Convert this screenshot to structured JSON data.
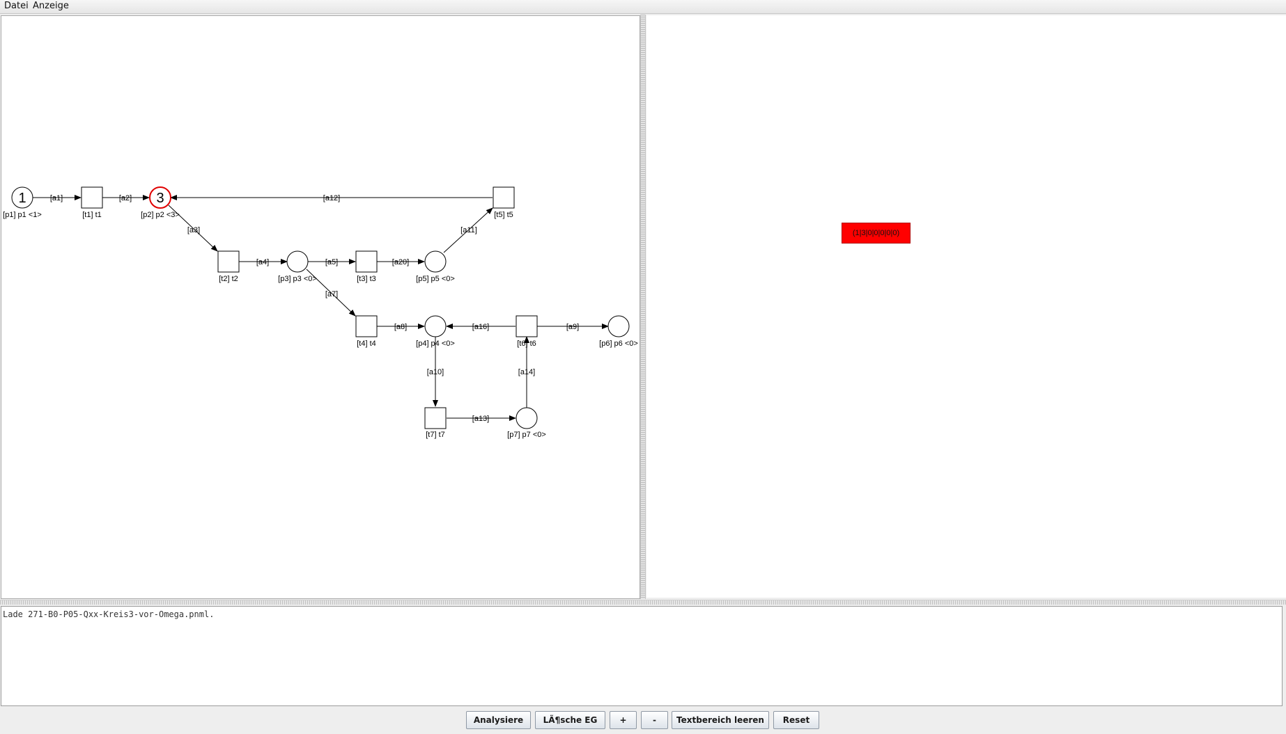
{
  "menu": {
    "file": "Datei",
    "view": "Anzeige"
  },
  "colors": {
    "state_fill": "#ff0000",
    "active_place": "#e00000"
  },
  "petri_net": {
    "places": [
      {
        "id": "p1",
        "label": "[p1] p1 <1>",
        "tokens": "1"
      },
      {
        "id": "p2",
        "label": "[p2] p2 <3>",
        "tokens": "3"
      },
      {
        "id": "p3",
        "label": "[p3] p3 <0>",
        "tokens": ""
      },
      {
        "id": "p5",
        "label": "[p5] p5 <0>",
        "tokens": ""
      },
      {
        "id": "p4",
        "label": "[p4] p4 <0>",
        "tokens": ""
      },
      {
        "id": "p6",
        "label": "[p6] p6 <0>",
        "tokens": ""
      },
      {
        "id": "p7",
        "label": "[p7] p7 <0>",
        "tokens": ""
      }
    ],
    "transitions": [
      {
        "id": "t1",
        "label": "[t1] t1"
      },
      {
        "id": "t5",
        "label": "[t5] t5"
      },
      {
        "id": "t2",
        "label": "[t2] t2"
      },
      {
        "id": "t3",
        "label": "[t3] t3"
      },
      {
        "id": "t4",
        "label": "[t4] t4"
      },
      {
        "id": "t6",
        "label": "[t6] t6"
      },
      {
        "id": "t7",
        "label": "[t7] t7"
      }
    ],
    "arcs": [
      {
        "id": "a1",
        "label": "[a1]"
      },
      {
        "id": "a2",
        "label": "[a2]"
      },
      {
        "id": "a12",
        "label": "[a12]"
      },
      {
        "id": "a3",
        "label": "[a3]"
      },
      {
        "id": "a11",
        "label": "[a11]"
      },
      {
        "id": "a4",
        "label": "[a4]"
      },
      {
        "id": "a5",
        "label": "[a5]"
      },
      {
        "id": "a20",
        "label": "[a20]"
      },
      {
        "id": "a7",
        "label": "[a7]"
      },
      {
        "id": "a8",
        "label": "[a8]"
      },
      {
        "id": "a16",
        "label": "[a16]"
      },
      {
        "id": "a9",
        "label": "[a9]"
      },
      {
        "id": "a10",
        "label": "[a10]"
      },
      {
        "id": "a14",
        "label": "[a14]"
      },
      {
        "id": "a13",
        "label": "[a13]"
      }
    ]
  },
  "reachability_graph": {
    "state_label": "(1|3|0|0|0|0|0)"
  },
  "log": {
    "text": "Lade 271-B0-P05-Qxx-Kreis3-vor-Omega.pnml."
  },
  "buttons": {
    "analyze": "Analysiere",
    "delete_graph": "LÃ¶sche EG",
    "zoom_in": "+",
    "zoom_out": "-",
    "clear_text": "Textbereich leeren",
    "reset": "Reset"
  }
}
